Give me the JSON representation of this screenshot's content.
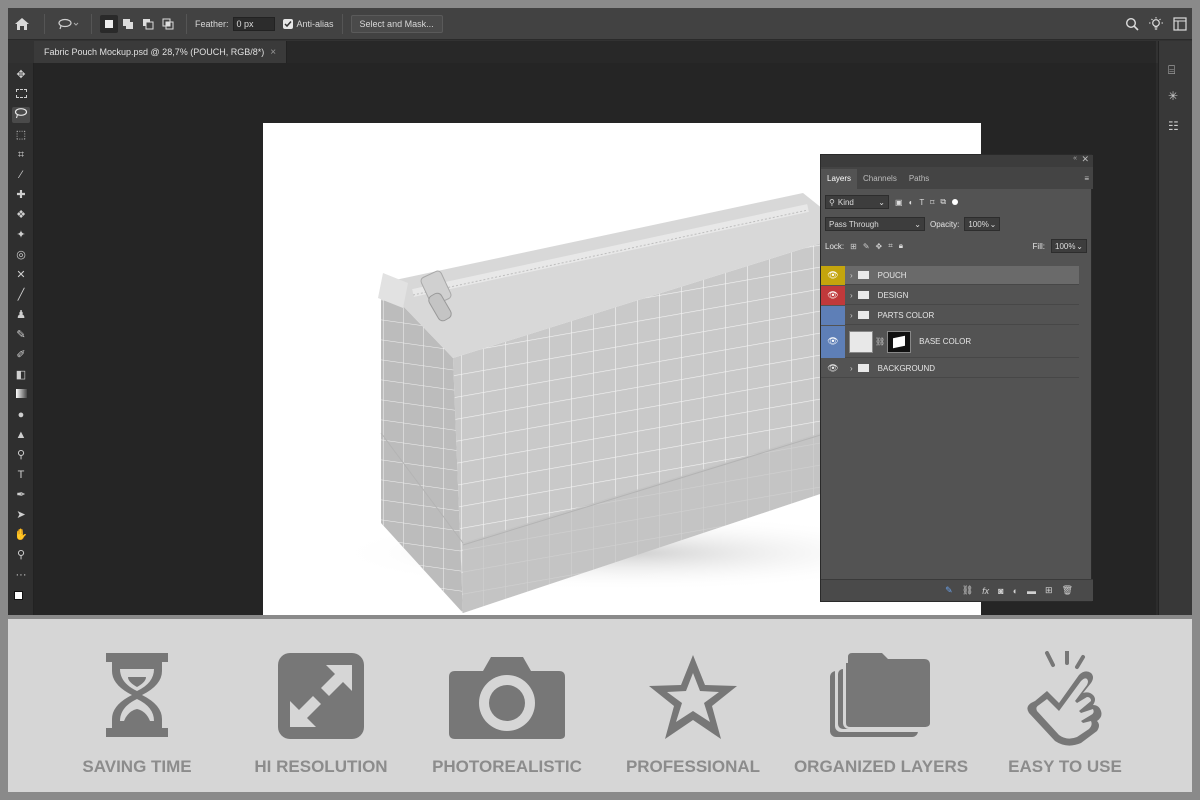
{
  "options_bar": {
    "feather_label": "Feather:",
    "feather_value": "0 px",
    "antialias_label": "Anti-alias",
    "antialias_checked": true,
    "select_mask_label": "Select and Mask..."
  },
  "document_tab": {
    "title": "Fabric Pouch Mockup.psd @ 28,7% (POUCH, RGB/8*)",
    "close": "×"
  },
  "layers_panel": {
    "tabs": [
      "Layers",
      "Channels",
      "Paths"
    ],
    "filter_kind": "Kind",
    "blend_mode": "Pass Through",
    "opacity_label": "Opacity:",
    "opacity_value": "100%",
    "lock_label": "Lock:",
    "fill_label": "Fill:",
    "fill_value": "100%",
    "layers": [
      {
        "name": "POUCH",
        "type": "group",
        "color": "#c4a50d",
        "selected": true
      },
      {
        "name": "DESIGN",
        "type": "group",
        "color": "#c0393b"
      },
      {
        "name": "PARTS COLOR",
        "type": "group",
        "color": "#5e7fb7",
        "hidden": true
      },
      {
        "name": "BASE COLOR",
        "type": "layer",
        "color": "#5e7fb7"
      },
      {
        "name": "BACKGROUND",
        "type": "group",
        "color": ""
      }
    ]
  },
  "features": [
    {
      "label": "SAVING TIME",
      "icon": "hourglass-icon"
    },
    {
      "label": "HI RESOLUTION",
      "icon": "expand-arrows-icon"
    },
    {
      "label": "PHOTOREALISTIC",
      "icon": "camera-icon"
    },
    {
      "label": "PROFESSIONAL",
      "icon": "star-icon"
    },
    {
      "label": "ORGANIZED LAYERS",
      "icon": "stacked-layers-icon"
    },
    {
      "label": "EASY TO USE",
      "icon": "tap-hand-icon"
    }
  ],
  "colors": {
    "icon_gray": "#777777",
    "label_gray": "#8c8c8c",
    "banner_bg": "#d6d6d6"
  }
}
